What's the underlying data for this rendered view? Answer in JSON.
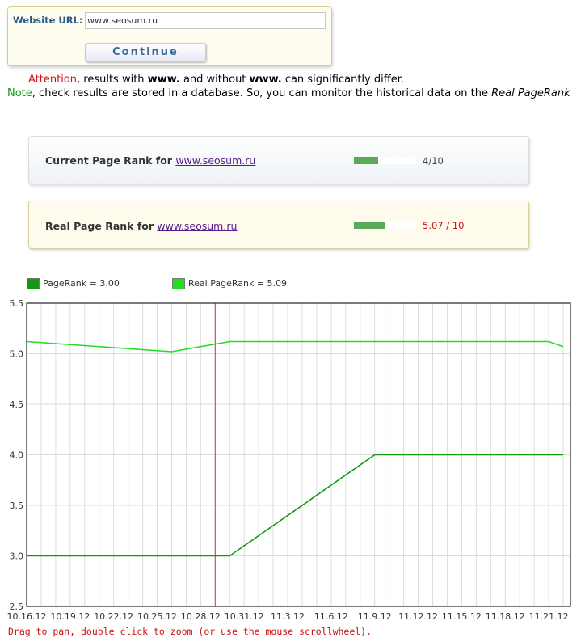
{
  "form": {
    "url_label": "Website URL:",
    "url_value": "www.seosum.ru",
    "continue_label": "Continue"
  },
  "notices": {
    "attention_word": "Attention",
    "attention_text_1": ", results with ",
    "www_1": "www.",
    "attention_text_2": " and without ",
    "www_2": "www.",
    "attention_text_3": " can significantly differ.",
    "note_word": "Note",
    "note_text": ", check results are stored in a database. So, you can monitor the historical data on the ",
    "note_italic": "Real PageRank"
  },
  "current_rank": {
    "label": "Current Page Rank for ",
    "site": "www.seosum.ru",
    "value_text": "4/10",
    "fraction": 0.4
  },
  "real_rank": {
    "label": "Real Page Rank for ",
    "site": "www.seosum.ru",
    "value_text": "5.07 / 10",
    "fraction": 0.507
  },
  "chart_data": {
    "type": "line",
    "xlabel": "",
    "ylabel": "",
    "ylim": [
      2.5,
      5.5
    ],
    "grid": true,
    "legend_placement": "top-left",
    "x_ticks": [
      "10.16.12",
      "10.19.12",
      "10.22.12",
      "10.25.12",
      "10.28.12",
      "10.31.12",
      "11.3.12",
      "11.6.12",
      "11.9.12",
      "11.12.12",
      "11.15.12",
      "11.18.12",
      "11.21.12"
    ],
    "y_ticks": [
      "2.5",
      "3.0",
      "3.5",
      "4.0",
      "4.5",
      "5.0",
      "5.5"
    ],
    "marker_date": "10.29.12",
    "series": [
      {
        "name": "PageRank = 3.00",
        "color": "#119911",
        "points": [
          [
            "10.16.12",
            3.0
          ],
          [
            "10.30.12",
            3.0
          ],
          [
            "11.9.12",
            4.0
          ],
          [
            "11.22.12",
            4.0
          ]
        ]
      },
      {
        "name": "Real PageRank = 5.09",
        "color": "#22dd22",
        "points": [
          [
            "10.16.12",
            5.12
          ],
          [
            "10.26.12",
            5.02
          ],
          [
            "10.30.12",
            5.12
          ],
          [
            "11.21.12",
            5.12
          ],
          [
            "11.22.12",
            5.07
          ]
        ]
      }
    ]
  },
  "help_text": "Drag to pan, double click to zoom (or use the mouse scrollwheel)."
}
